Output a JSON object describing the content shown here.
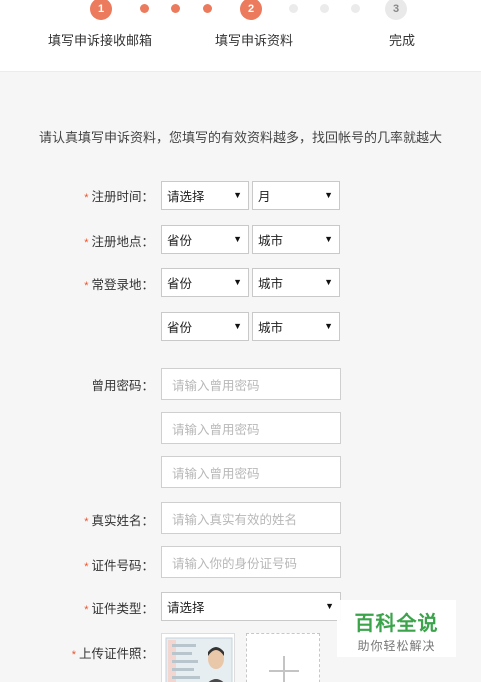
{
  "steps": [
    {
      "num": "1",
      "label": "填写申诉接收邮箱",
      "state": "active"
    },
    {
      "num": "2",
      "label": "填写申诉资料",
      "state": "active"
    },
    {
      "num": "3",
      "label": "完成",
      "state": "inactive"
    }
  ],
  "intro": "请认真填写申诉资料，您填写的有效资料越多，找回帐号的几率就越大",
  "required_mark": "*",
  "arrow_glyph": "▼",
  "form": {
    "reg_time": {
      "label": "注册时间：",
      "select1": "请选择",
      "select2": "月"
    },
    "reg_place": {
      "label": "注册地点：",
      "select1": "省份",
      "select2": "城市"
    },
    "login_place": {
      "label": "常登录地：",
      "select1": "省份",
      "select2": "城市",
      "select3": "省份",
      "select4": "城市"
    },
    "old_password": {
      "label": "曾用密码：",
      "placeholders": [
        "请输入曾用密码",
        "请输入曾用密码",
        "请输入曾用密码"
      ]
    },
    "real_name": {
      "label": "真实姓名：",
      "placeholder": "请输入真实有效的姓名"
    },
    "id_number": {
      "label": "证件号码：",
      "placeholder": "请输入你的身份证号码"
    },
    "id_type": {
      "label": "证件类型：",
      "select": "请选择"
    },
    "id_photo": {
      "label": "上传证件照："
    }
  },
  "watermark": {
    "title": "百科全说",
    "subtitle": "助你轻松解决"
  },
  "colors": {
    "accent": "#ec7a5c",
    "required": "#e8552d",
    "watermark": "#3ba44b"
  }
}
